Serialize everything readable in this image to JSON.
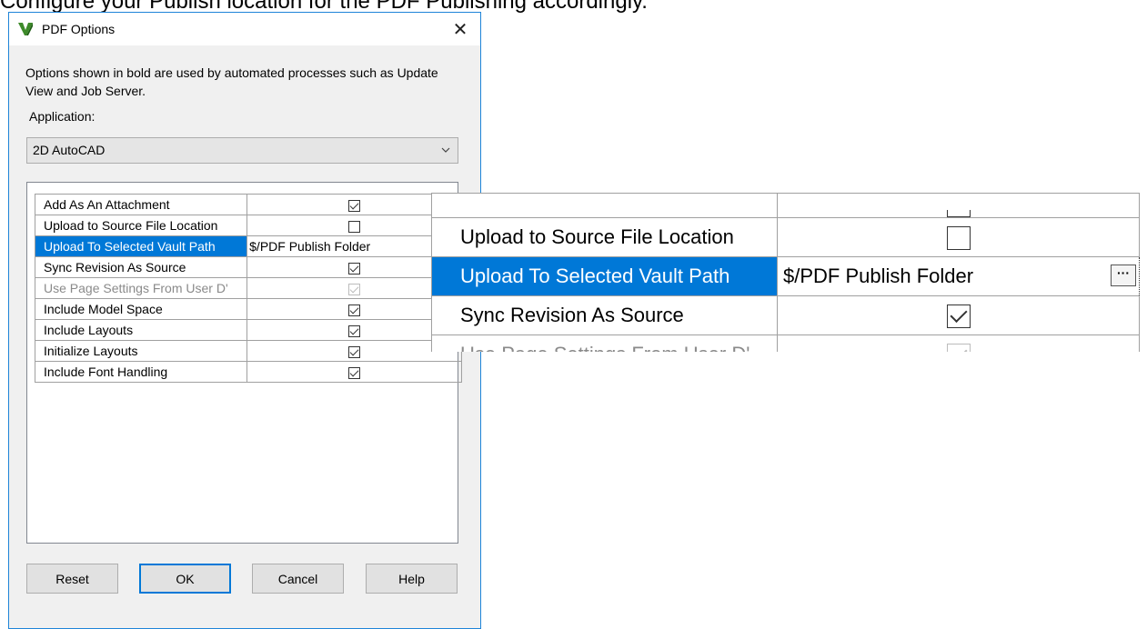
{
  "caption": "Configure your Publish location for the PDF Publishing accordingly.",
  "dialog": {
    "title": "PDF Options",
    "close_glyph": "✕",
    "description": "Options shown in bold are used by automated processes such as Update View and Job Server.",
    "application_label": "Application:",
    "application_value": "2D AutoCAD",
    "properties": [
      {
        "name": "Add As An Attachment",
        "checked": true,
        "disabled": false
      },
      {
        "name": "Upload to Source File Location",
        "checked": false,
        "disabled": false
      },
      {
        "name": "Upload To Selected Vault Path",
        "value": "$/PDF Publish Folder",
        "selected": true
      },
      {
        "name": "Sync Revision As Source",
        "checked": true,
        "disabled": false
      },
      {
        "name": "Use Page Settings From User D'",
        "checked": true,
        "disabled": true
      },
      {
        "name": "Include Model Space",
        "checked": true,
        "disabled": false
      },
      {
        "name": "Include Layouts",
        "checked": true,
        "disabled": false
      },
      {
        "name": "Initialize Layouts",
        "checked": true,
        "disabled": false
      },
      {
        "name": "Include Font Handling",
        "checked": true,
        "disabled": false
      }
    ],
    "buttons": {
      "reset": "Reset",
      "ok": "OK",
      "cancel": "Cancel",
      "help": "Help"
    }
  },
  "zoom": {
    "rows": [
      {
        "name": "Upload to Source File Location",
        "checked": false,
        "disabled": false
      },
      {
        "name": "Upload To Selected Vault Path",
        "value": "$/PDF Publish Folder",
        "selected": true
      },
      {
        "name": "Sync Revision As Source",
        "checked": true,
        "disabled": false
      },
      {
        "name": "Use Page Settings From User D'",
        "checked": true,
        "disabled": true
      }
    ],
    "ellipsis": "···"
  },
  "colors": {
    "accent": "#0078d7",
    "dialog_bg": "#f0f0f0"
  },
  "icons": {
    "app": "vault-logo-icon",
    "close": "close-icon",
    "dropdown": "chevron-down-icon"
  }
}
